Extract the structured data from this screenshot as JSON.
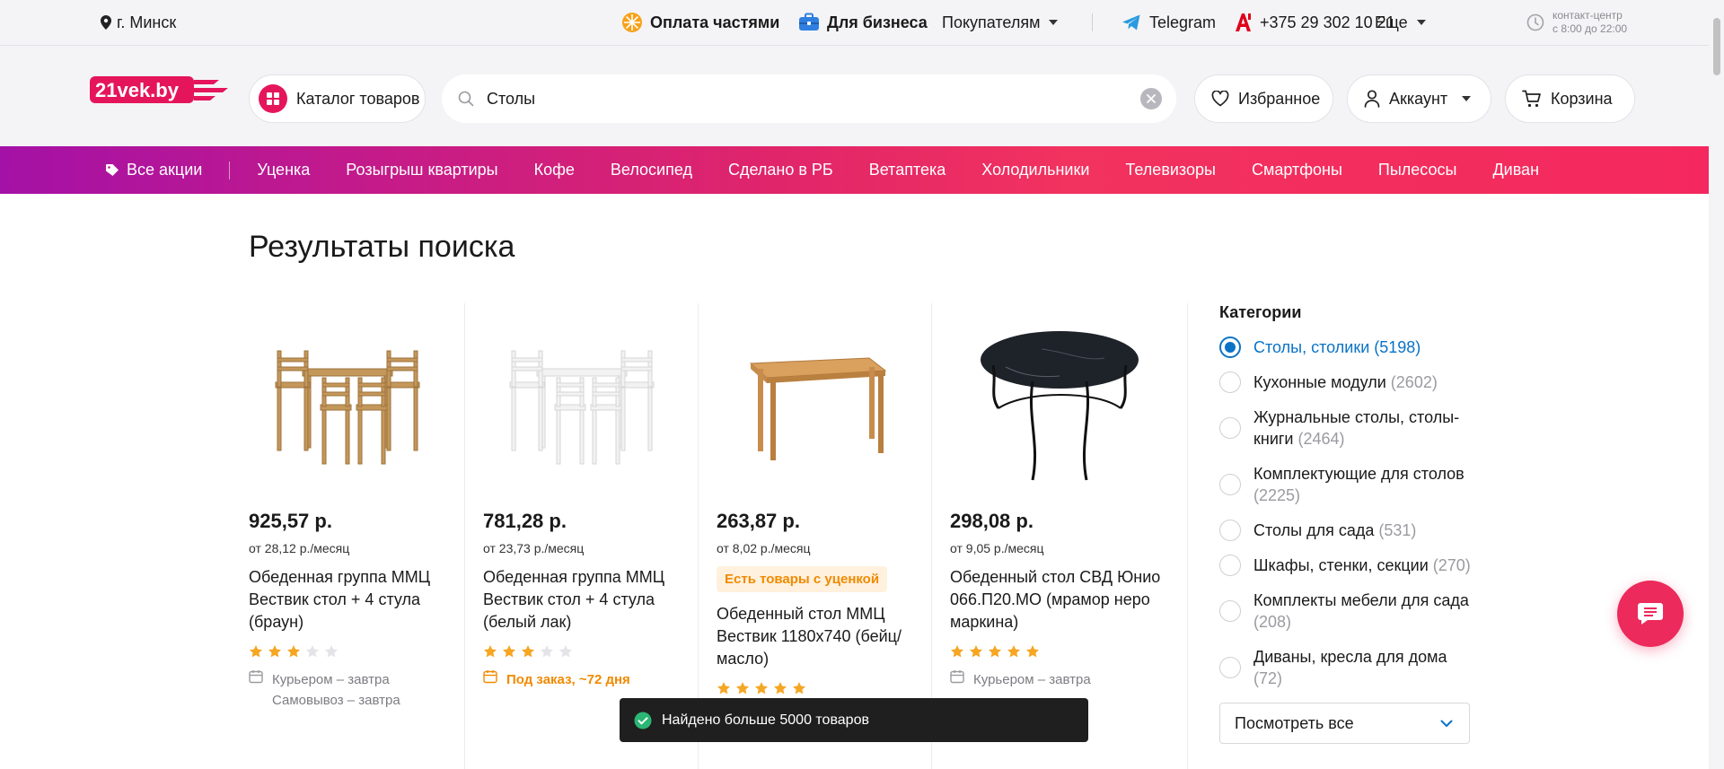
{
  "topbar": {
    "city": "г. Минск",
    "pay_parts": "Оплата частями",
    "business": "Для бизнеса",
    "buyers": "Покупателям",
    "telegram": "Telegram",
    "phone": "+375 29 302 10 21",
    "more": "Еще",
    "contact_center_line1": "контакт-центр",
    "contact_center_line2": "с 8:00 до 22:00"
  },
  "header": {
    "logo_text": "21vek.by",
    "catalog_label": "Каталог товаров",
    "search_value": "Столы",
    "favorites_label": "Избранное",
    "account_label": "Аккаунт",
    "cart_label": "Корзина"
  },
  "promo_nav": {
    "all_promos": "Все акции",
    "items": [
      "Уценка",
      "Розыгрыш квартиры",
      "Кофе",
      "Велосипед",
      "Сделано в РБ",
      "Ветаптека",
      "Холодильники",
      "Телевизоры",
      "Смартфоны",
      "Пылесосы",
      "Диван"
    ]
  },
  "main": {
    "title": "Результаты поиска",
    "products": [
      {
        "price": "925,57 р.",
        "monthly": "от 28,12 р./месяц",
        "name": "Обеденная группа ММЦ Вествик стол + 4 стула (браун)",
        "rating": 3,
        "delivery": "Курьером – завтра",
        "pickup": "Самовывоз – завтра",
        "badge": ""
      },
      {
        "price": "781,28 р.",
        "monthly": "от 23,73 р./месяц",
        "name": "Обеденная группа ММЦ Вествик стол + 4 стула (белый лак)",
        "rating": 3,
        "delivery": "Под заказ, ~72 дня",
        "badge": ""
      },
      {
        "price": "263,87 р.",
        "monthly": "от 8,02 р./месяц",
        "badge": "Есть товары с уценкой",
        "name": "Обеденный стол ММЦ Вествик 1180x740 (бейц/масло)",
        "rating": 5
      },
      {
        "price": "298,08 р.",
        "monthly": "от 9,05 р./месяц",
        "name": "Обеденный стол СВД Юнио 066.П20.МО (мрамор неро маркина)",
        "rating": 5,
        "delivery": "Курьером – завтра",
        "badge": ""
      }
    ]
  },
  "sidebar": {
    "title": "Категории",
    "categories": [
      {
        "label": "Столы, столики",
        "count": "(5198)",
        "selected": true
      },
      {
        "label": "Кухонные модули",
        "count": "(2602)",
        "selected": false
      },
      {
        "label": "Журнальные столы, столы-книги",
        "count": "(2464)",
        "selected": false
      },
      {
        "label": "Комплектующие для столов",
        "count": "(2225)",
        "selected": false
      },
      {
        "label": "Столы для сада",
        "count": "(531)",
        "selected": false
      },
      {
        "label": "Шкафы, стенки, секции",
        "count": "(270)",
        "selected": false
      },
      {
        "label": "Комплекты мебели для сада",
        "count": "(208)",
        "selected": false
      },
      {
        "label": "Диваны, кресла для дома",
        "count": "(72)",
        "selected": false
      }
    ],
    "see_all": "Посмотреть все"
  },
  "toast": {
    "message": "Найдено больше 5000 товаров"
  },
  "colors": {
    "brand": "#e5155b",
    "accent_blue": "#0a73c6",
    "star": "#f5a623",
    "orange": "#f08a00"
  },
  "icons": {
    "location": "location-pin-icon",
    "pay": "orange-slice-icon",
    "business": "briefcase-icon",
    "telegram": "telegram-icon",
    "operator": "a1-logo-icon",
    "clock": "clock-icon",
    "catalog": "grid-icon",
    "search": "search-icon",
    "clear": "clear-icon",
    "favorites": "heart-icon",
    "account": "user-icon",
    "cart": "cart-icon",
    "promo": "tag-icon",
    "calendar": "calendar-icon",
    "chat": "chat-icon",
    "check": "check-circle-icon"
  }
}
